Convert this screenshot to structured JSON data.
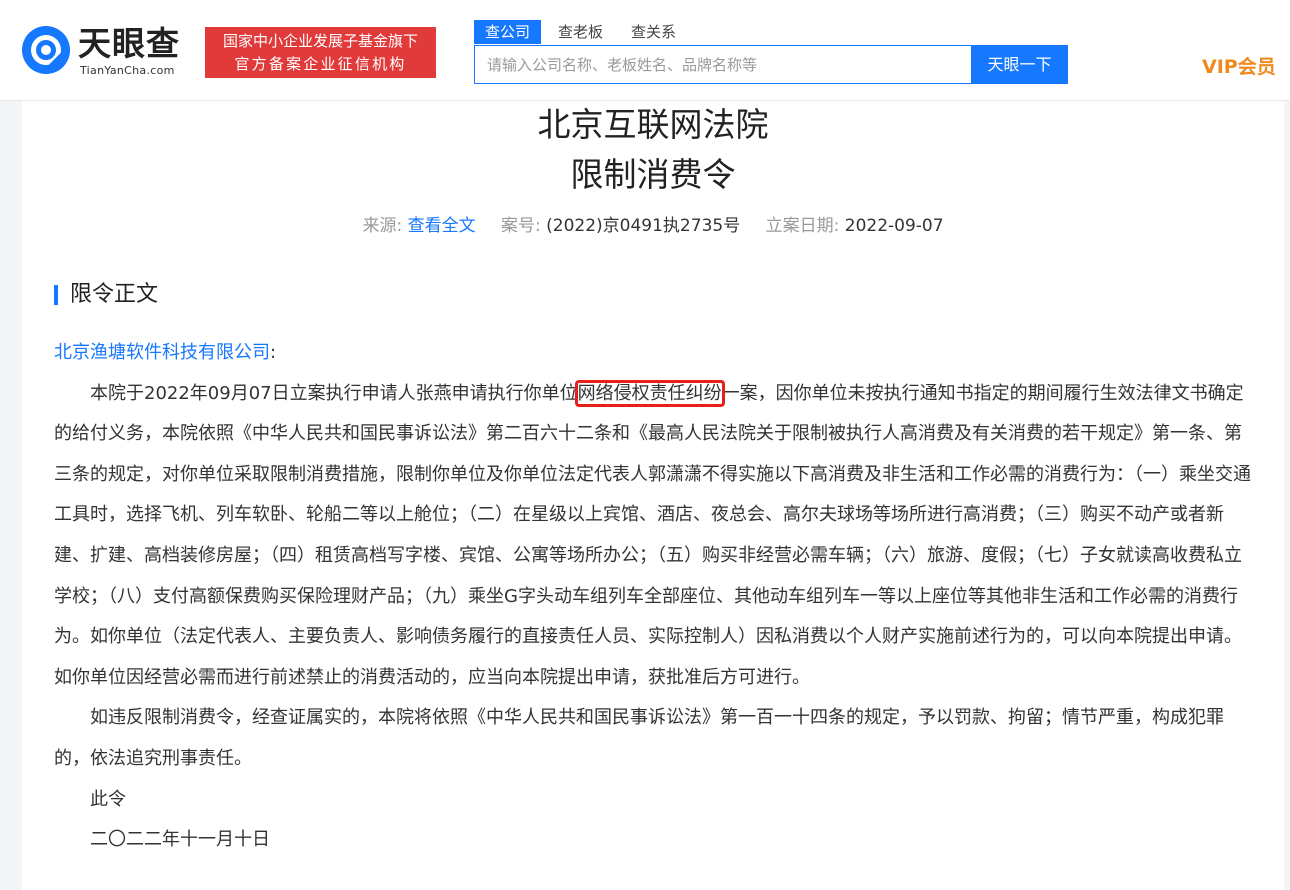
{
  "header": {
    "logo_cn": "天眼查",
    "logo_en": "TianYanCha.com",
    "badge_line1": "国家中小企业发展子基金旗下",
    "badge_line2": "官方备案企业征信机构",
    "tabs": [
      {
        "label": "查公司",
        "active": true
      },
      {
        "label": "查老板",
        "active": false
      },
      {
        "label": "查关系",
        "active": false
      }
    ],
    "search_placeholder": "请输入公司名称、老板姓名、品牌名称等",
    "search_button": "天眼一下",
    "vip_label": "VIP会员"
  },
  "document": {
    "court": "北京互联网法院",
    "order_type": "限制消费令",
    "meta": {
      "source_label": "来源:",
      "source_link": "查看全文",
      "case_no_label": "案号:",
      "case_no": "(2022)京0491执2735号",
      "filing_date_label": "立案日期:",
      "filing_date": "2022-09-07"
    },
    "section_title": "限令正文",
    "addressee": "北京渔塘软件科技有限公司",
    "addressee_suffix": ":",
    "para1_before": "本院于2022年09月07日立案执行申请人张燕申请执行你单位",
    "para1_highlight": "网络侵权责任纠纷",
    "para1_after": "一案，因你单位未按执行通知书指定的期间履行生效法律文书确定的给付义务，本院依照《中华人民共和国民事诉讼法》第二百六十二条和《最高人民法院关于限制被执行人高消费及有关消费的若干规定》第一条、第三条的规定，对你单位采取限制消费措施，限制你单位及你单位法定代表人郭潇潇不得实施以下高消费及非生活和工作必需的消费行为：（一）乘坐交通工具时，选择飞机、列车软卧、轮船二等以上舱位；（二）在星级以上宾馆、酒店、夜总会、高尔夫球场等场所进行高消费；（三）购买不动产或者新建、扩建、高档装修房屋；（四）租赁高档写字楼、宾馆、公寓等场所办公；（五）购买非经营必需车辆；（六）旅游、度假；（七）子女就读高收费私立学校；（八）支付高额保费购买保险理财产品；（九）乘坐G字头动车组列车全部座位、其他动车组列车一等以上座位等其他非生活和工作必需的消费行为。如你单位（法定代表人、主要负责人、影响债务履行的直接责任人员、实际控制人）因私消费以个人财产实施前述行为的，可以向本院提出申请。如你单位因经营必需而进行前述禁止的消费活动的，应当向本院提出申请，获批准后方可进行。",
    "para2": "如违反限制消费令，经查证属实的，本院将依照《中华人民共和国民事诉讼法》第一百一十四条的规定，予以罚款、拘留；情节严重，构成犯罪的，依法追究刑事责任。",
    "closing": "此令",
    "date_cn": "二〇二二年十一月十日"
  },
  "colors": {
    "brand_blue": "#1677ff",
    "badge_red": "#e03a3a",
    "vip_orange": "#f08a1e",
    "highlight_box": "#e6201a"
  }
}
